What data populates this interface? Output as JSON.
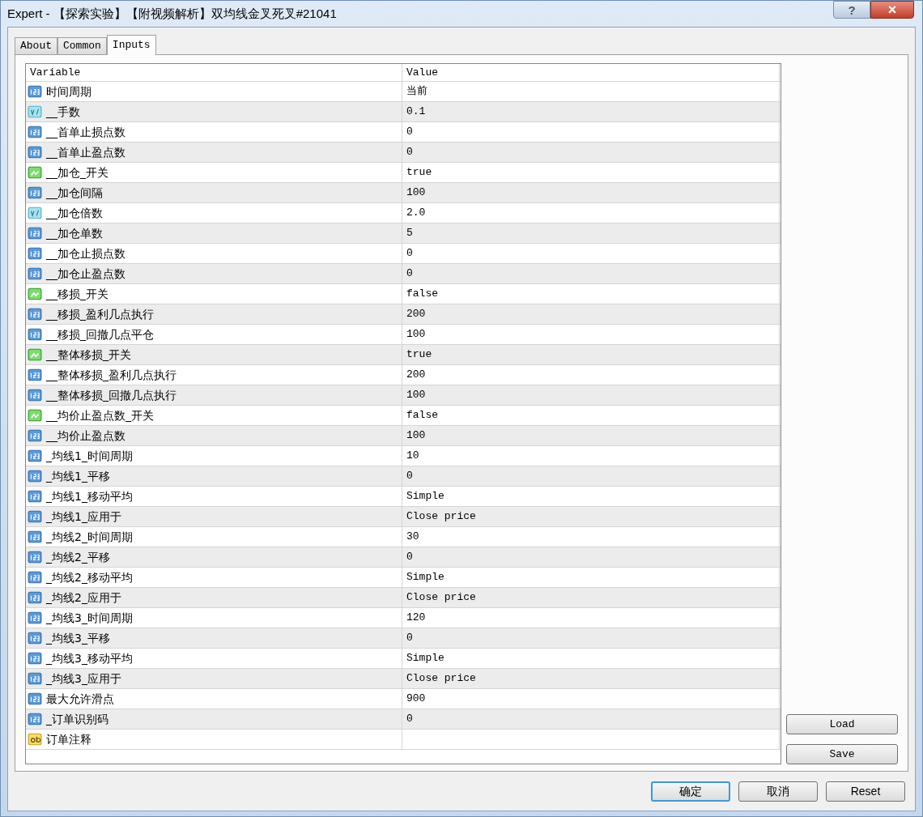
{
  "window": {
    "title": "Expert - 【探索实验】【附视频解析】双均线金叉死叉#21041",
    "help_button": "?",
    "close_button": "×"
  },
  "tabs": [
    {
      "label": "About",
      "selected": false
    },
    {
      "label": "Common",
      "selected": false
    },
    {
      "label": "Inputs",
      "selected": true
    }
  ],
  "table": {
    "columns": [
      "Variable",
      "Value"
    ],
    "rows": [
      {
        "kind": "int",
        "variable": "时间周期",
        "value": "当前"
      },
      {
        "kind": "double",
        "variable": "__手数",
        "value": "0.1"
      },
      {
        "kind": "int",
        "variable": "__首单止损点数",
        "value": "0"
      },
      {
        "kind": "int",
        "variable": "__首单止盈点数",
        "value": "0"
      },
      {
        "kind": "bool",
        "variable": "__加仓_开关",
        "value": "true"
      },
      {
        "kind": "int",
        "variable": "__加仓间隔",
        "value": "100"
      },
      {
        "kind": "double",
        "variable": "__加仓倍数",
        "value": "2.0"
      },
      {
        "kind": "int",
        "variable": "__加仓单数",
        "value": "5"
      },
      {
        "kind": "int",
        "variable": "__加仓止损点数",
        "value": "0"
      },
      {
        "kind": "int",
        "variable": "__加仓止盈点数",
        "value": "0"
      },
      {
        "kind": "bool",
        "variable": "__移损_开关",
        "value": "false"
      },
      {
        "kind": "int",
        "variable": "__移损_盈利几点执行",
        "value": "200"
      },
      {
        "kind": "int",
        "variable": "__移损_回撤几点平仓",
        "value": "100"
      },
      {
        "kind": "bool",
        "variable": "__整体移损_开关",
        "value": "true"
      },
      {
        "kind": "int",
        "variable": "__整体移损_盈利几点执行",
        "value": "200"
      },
      {
        "kind": "int",
        "variable": "__整体移损_回撤几点执行",
        "value": "100"
      },
      {
        "kind": "bool",
        "variable": "__均价止盈点数_开关",
        "value": "false"
      },
      {
        "kind": "int",
        "variable": "__均价止盈点数",
        "value": "100"
      },
      {
        "kind": "int",
        "variable": "_均线1_时间周期",
        "value": "10"
      },
      {
        "kind": "int",
        "variable": "_均线1_平移",
        "value": "0"
      },
      {
        "kind": "int",
        "variable": "_均线1_移动平均",
        "value": "Simple"
      },
      {
        "kind": "int",
        "variable": "_均线1_应用于",
        "value": "Close price"
      },
      {
        "kind": "int",
        "variable": "_均线2_时间周期",
        "value": "30"
      },
      {
        "kind": "int",
        "variable": "_均线2_平移",
        "value": "0"
      },
      {
        "kind": "int",
        "variable": "_均线2_移动平均",
        "value": "Simple"
      },
      {
        "kind": "int",
        "variable": "_均线2_应用于",
        "value": "Close price"
      },
      {
        "kind": "int",
        "variable": "_均线3_时间周期",
        "value": "120"
      },
      {
        "kind": "int",
        "variable": "_均线3_平移",
        "value": "0"
      },
      {
        "kind": "int",
        "variable": "_均线3_移动平均",
        "value": "Simple"
      },
      {
        "kind": "int",
        "variable": "_均线3_应用于",
        "value": "Close price"
      },
      {
        "kind": "int",
        "variable": "最大允许滑点",
        "value": "900"
      },
      {
        "kind": "int",
        "variable": "_订单识别码",
        "value": "0"
      },
      {
        "kind": "string",
        "variable": "订单注释",
        "value": ""
      }
    ]
  },
  "side_buttons": [
    "Load",
    "Save"
  ],
  "buttons": [
    {
      "label": "确定",
      "default": true
    },
    {
      "label": "取消",
      "default": false
    },
    {
      "label": "Reset",
      "default": false
    }
  ]
}
